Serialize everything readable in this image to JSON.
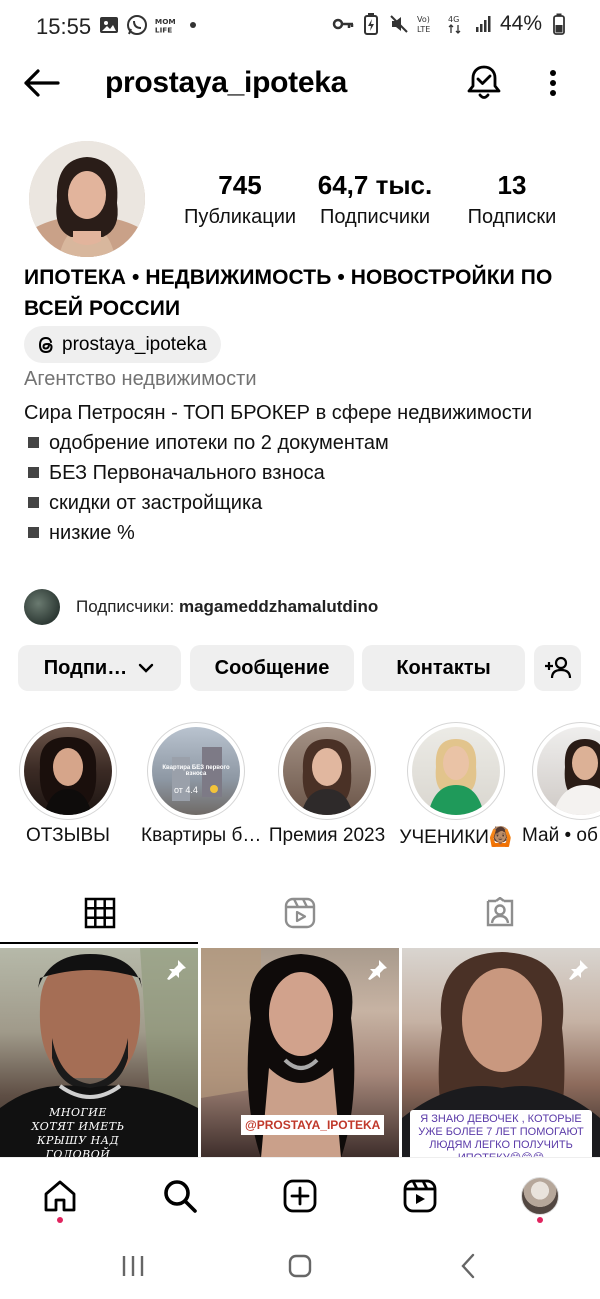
{
  "status_bar": {
    "time": "15:55",
    "left_icons": [
      "image-icon",
      "whatsapp-icon",
      "mom-life-icon",
      "dot-icon"
    ],
    "right_icons": [
      "key-icon",
      "battery-saver-icon",
      "mute-icon",
      "volte-icon",
      "4g-icon",
      "signal-icon"
    ],
    "battery": "44%"
  },
  "header": {
    "username": "prostaya_ipoteka"
  },
  "profile": {
    "stats": {
      "posts_count": "745",
      "posts_label": "Публикации",
      "followers_count": "64,7 тыс.",
      "followers_label": "Подписчики",
      "following_count": "13",
      "following_label": "Подписки"
    },
    "title": "ИПОТЕКА • НЕДВИЖИМОСТЬ • НОВОСТРОЙКИ ПО ВСЕЙ РОССИИ",
    "threads_handle": "prostaya_ipoteka",
    "category": "Агентство недвижимости",
    "bio_intro": "Сира Петросян - ТОП БРОКЕР в сфере недвижимости",
    "bio_bullets": [
      "одобрение ипотеки по 2 документам",
      "БЕЗ Первоначального взноса",
      "скидки от застройщика",
      "низкие %"
    ],
    "followed_by_prefix": "Подписчики: ",
    "followed_by_user": "magameddzhamalutdino"
  },
  "actions": {
    "follow_label": "Подпи…",
    "message_label": "Сообщение",
    "contacts_label": "Контакты"
  },
  "highlights": [
    {
      "label": "ОТЗЫВЫ"
    },
    {
      "label": "Квартиры б…",
      "overlay_text": "Квартира БЕЗ первого взноса",
      "overlay_price": "от 4.4"
    },
    {
      "label": "Премия 2023"
    },
    {
      "label": "УЧЕНИКИ🙆🏽"
    },
    {
      "label": "Май • об"
    }
  ],
  "posts": [
    {
      "caption": "МНОГИЕ ХОТЯТ ИМЕТЬ КРЫШУ НАД ГОЛОВОЙ"
    },
    {
      "caption": "@PROSTAYA_IPOTEKA"
    },
    {
      "caption": "Я ЗНАЮ ДЕВОЧЕК , КОТОРЫЕ УЖЕ БОЛЕЕ 7 ЛЕТ ПОМОГАЮТ ЛЮДЯМ ЛЕГКО ПОЛУЧИТЬ ИПОТЕКУ😊😊😊"
    }
  ],
  "colors": {
    "button_bg": "#efefef",
    "notification_dot": "#e0245e",
    "secondary_text": "#737373"
  }
}
